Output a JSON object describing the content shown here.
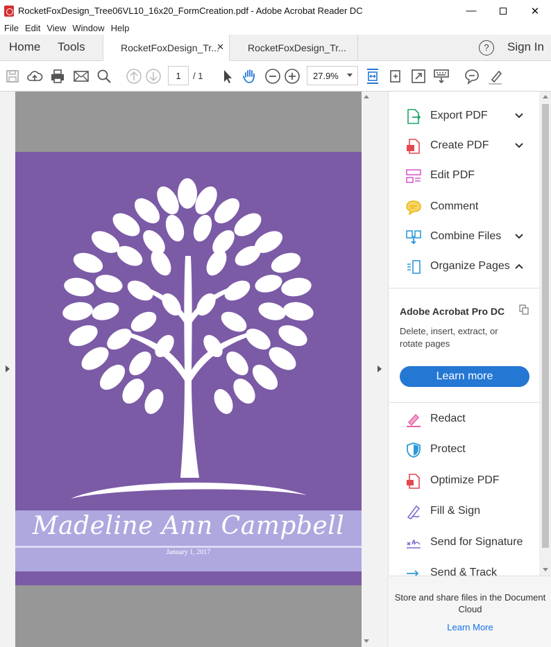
{
  "window": {
    "title": "RocketFoxDesign_Tree06VL10_16x20_FormCreation.pdf - Adobe Acrobat Reader DC",
    "minimize": "—",
    "close": "✕"
  },
  "menu": [
    "File",
    "Edit",
    "View",
    "Window",
    "Help"
  ],
  "tabs": {
    "home": "Home",
    "tools": "Tools",
    "documents": [
      {
        "label": "RocketFoxDesign_Tr...",
        "active": true
      },
      {
        "label": "RocketFoxDesign_Tr...",
        "active": false
      }
    ],
    "help": "?",
    "sign_in": "Sign In"
  },
  "toolbar": {
    "page_current": "1",
    "page_total": "/ 1",
    "zoom": "27.9%"
  },
  "document": {
    "name": "Madeline Ann Campbell",
    "date": "January 1, 2017",
    "colors": {
      "background": "#7b5aa6",
      "band": "#aea8df",
      "tree": "#ffffff"
    }
  },
  "tools_pane": {
    "items": [
      {
        "label": "Export PDF",
        "icon": "export-pdf-icon",
        "expander": "down",
        "color": "#21a366"
      },
      {
        "label": "Create PDF",
        "icon": "create-pdf-icon",
        "expander": "down",
        "color": "#e34850"
      },
      {
        "label": "Edit PDF",
        "icon": "edit-pdf-icon",
        "expander": "",
        "color": "#d95bd0"
      },
      {
        "label": "Comment",
        "icon": "comment-icon",
        "expander": "",
        "color": "#e8b600"
      },
      {
        "label": "Combine Files",
        "icon": "combine-files-icon",
        "expander": "down",
        "color": "#2d9ad8"
      },
      {
        "label": "Organize Pages",
        "icon": "organize-pages-icon",
        "expander": "up",
        "color": "#2d9ad8"
      },
      {
        "label": "Redact",
        "icon": "redact-icon",
        "expander": "",
        "color": "#e65fa8"
      },
      {
        "label": "Protect",
        "icon": "protect-icon",
        "expander": "",
        "color": "#2d9ad8"
      },
      {
        "label": "Optimize PDF",
        "icon": "optimize-pdf-icon",
        "expander": "",
        "color": "#e34850"
      },
      {
        "label": "Fill & Sign",
        "icon": "fill-sign-icon",
        "expander": "",
        "color": "#7a6fd0"
      },
      {
        "label": "Send for Signature",
        "icon": "send-for-signature-icon",
        "expander": "",
        "color": "#7a6fd0"
      },
      {
        "label": "Send & Track",
        "icon": "send-track-icon",
        "expander": "",
        "color": "#2d9ad8"
      }
    ],
    "promo": {
      "title": "Adobe Acrobat Pro DC",
      "description": "Delete, insert, extract, or rotate pages",
      "button": "Learn more"
    },
    "cloud": {
      "text": "Store and share files in the Document Cloud",
      "link": "Learn More"
    }
  }
}
